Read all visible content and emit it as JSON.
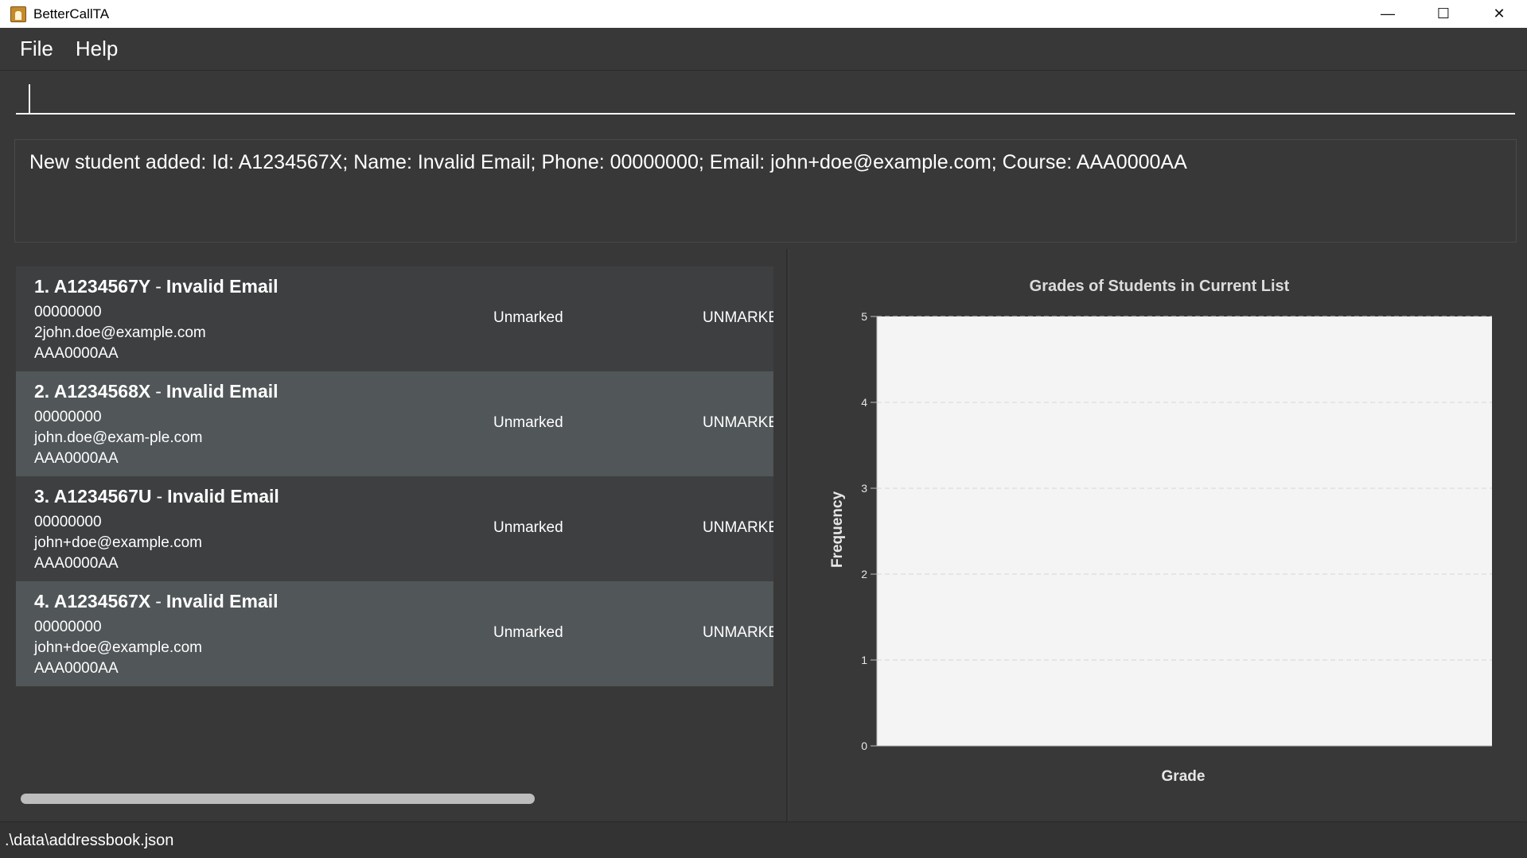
{
  "window": {
    "title": "BetterCallTA",
    "minimize_glyph": "—",
    "maximize_glyph": "☐",
    "close_glyph": "✕"
  },
  "menu": {
    "items": [
      "File",
      "Help"
    ]
  },
  "command": {
    "value": "",
    "placeholder": ""
  },
  "result": {
    "text": "New student added: Id: A1234567X; Name: Invalid Email; Phone: 00000000; Email: john+doe@example.com; Course: AAA0000AA"
  },
  "students": [
    {
      "index": "1.",
      "id": "A1234567Y",
      "name": "Invalid Email",
      "phone": "00000000",
      "email": "2john.doe@example.com",
      "course": "AAA0000AA",
      "status": "Unmarked",
      "grade": "UNMARKE"
    },
    {
      "index": "2.",
      "id": "A1234568X",
      "name": "Invalid Email",
      "phone": "00000000",
      "email": "john.doe@exam-ple.com",
      "course": "AAA0000AA",
      "status": "Unmarked",
      "grade": "UNMARKE"
    },
    {
      "index": "3.",
      "id": "A1234567U",
      "name": "Invalid Email",
      "phone": "00000000",
      "email": "john+doe@example.com",
      "course": "AAA0000AA",
      "status": "Unmarked",
      "grade": "UNMARKE"
    },
    {
      "index": "4.",
      "id": "A1234567X",
      "name": "Invalid Email",
      "phone": "00000000",
      "email": "john+doe@example.com",
      "course": "AAA0000AA",
      "status": "Unmarked",
      "grade": "UNMARKE"
    }
  ],
  "chart_data": {
    "type": "bar",
    "title": "Grades of Students in Current List",
    "xlabel": "Grade",
    "ylabel": "Frequency",
    "categories": [],
    "values": [],
    "ylim": [
      0,
      5
    ],
    "yticks": [
      "0",
      "1",
      "2",
      "3",
      "4",
      "5"
    ],
    "grid": true
  },
  "status_bar": {
    "path": ".\\data\\addressbook.json"
  },
  "colors": {
    "background": "#383838",
    "card_odd": "#3e3f41",
    "card_even": "#515658",
    "plot_bg": "#f4f4f4"
  }
}
